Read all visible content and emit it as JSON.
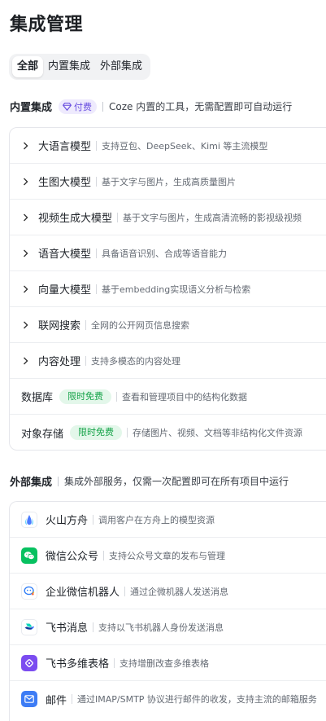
{
  "page": {
    "title": "集成管理"
  },
  "tabs": [
    {
      "label": "全部",
      "active": true
    },
    {
      "label": "内置集成",
      "active": false
    },
    {
      "label": "外部集成",
      "active": false
    }
  ],
  "builtin": {
    "title": "内置集成",
    "badge": "付费",
    "description": "Coze 内置的工具，无需配置即可自动运行",
    "items": [
      {
        "name": "大语言模型",
        "desc": "支持豆包、DeepSeek、Kimi 等主流模型"
      },
      {
        "name": "生图大模型",
        "desc": "基于文字与图片，生成高质量图片"
      },
      {
        "name": "视频生成大模型",
        "desc": "基于文字与图片，生成高清流畅的影视级视频"
      },
      {
        "name": "语音大模型",
        "desc": "具备语音识别、合成等语音能力"
      },
      {
        "name": "向量大模型",
        "desc": "基于embedding实现语义分析与检索"
      },
      {
        "name": "联网搜索",
        "desc": "全网的公开网页信息搜索"
      },
      {
        "name": "内容处理",
        "desc": "支持多模态的内容处理"
      }
    ],
    "plain_items": [
      {
        "name": "数据库",
        "badge": "限时免费",
        "desc": "查看和管理项目中的结构化数据"
      },
      {
        "name": "对象存储",
        "badge": "限时免费",
        "desc": "存储图片、视频、文档等非结构化文件资源"
      }
    ]
  },
  "external": {
    "title": "外部集成",
    "description": "集成外部服务，仅需一次配置即可在所有项目中运行",
    "items": [
      {
        "name": "火山方舟",
        "desc": "调用客户在方舟上的模型资源",
        "icon": "volcano-ark-icon"
      },
      {
        "name": "微信公众号",
        "desc": "支持公众号文章的发布与管理",
        "icon": "wechat-icon"
      },
      {
        "name": "企业微信机器人",
        "desc": "通过企微机器人发送消息",
        "icon": "wecom-bot-icon"
      },
      {
        "name": "飞书消息",
        "desc": "支持以飞书机器人身份发送消息",
        "icon": "feishu-icon"
      },
      {
        "name": "飞书多维表格",
        "desc": "支持增删改查多维表格",
        "icon": "feishu-bitable-icon"
      },
      {
        "name": "邮件",
        "desc": "通过IMAP/SMTP 协议进行邮件的收发，支持主流的邮箱服务",
        "icon": "mail-icon"
      }
    ]
  },
  "colors": {
    "paid_badge_bg": "#eeeafd",
    "paid_badge_text": "#6a4fe0",
    "free_badge_bg": "#e3f7ea",
    "free_badge_text": "#18a44b",
    "wechat": "#07c160",
    "feishu_bitable": "#7b4cf0",
    "mail": "#3d7cf5"
  }
}
